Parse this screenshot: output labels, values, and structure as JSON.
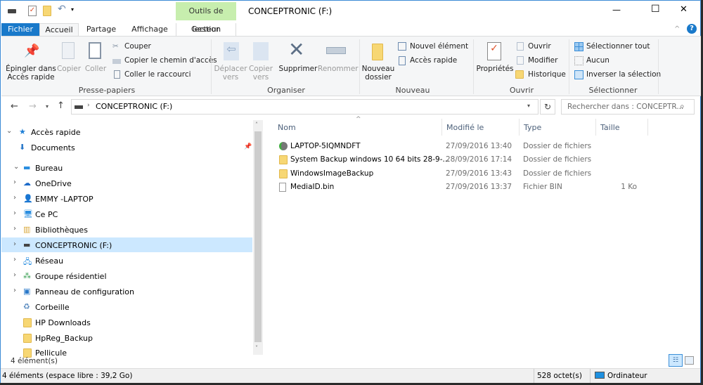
{
  "window": {
    "title": "CONCEPTRONIC (F:)",
    "context_tab": "Outils de lecteur",
    "controls": {
      "minimize": "—",
      "maximize": "☐",
      "close": "✕"
    }
  },
  "tabs": [
    "Fichier",
    "Accueil",
    "Partage",
    "Affichage",
    "Gestion"
  ],
  "ribbon": {
    "clipboard": {
      "pin": "Épingler dans Accès rapide",
      "copy": "Copier",
      "paste": "Coller",
      "cut": "Couper",
      "copy_path": "Copier le chemin d'accès",
      "paste_shortcut": "Coller le raccourci",
      "group": "Presse-papiers"
    },
    "organize": {
      "move": "Déplacer vers",
      "copy_to": "Copier vers",
      "delete": "Supprimer",
      "rename": "Renommer",
      "group": "Organiser"
    },
    "new": {
      "new_folder": "Nouveau dossier",
      "new_item": "Nouvel élément",
      "easy_access": "Accès rapide",
      "group": "Nouveau"
    },
    "open": {
      "properties": "Propriétés",
      "open": "Ouvrir",
      "edit": "Modifier",
      "history": "Historique",
      "group": "Ouvrir"
    },
    "select": {
      "all": "Sélectionner tout",
      "none": "Aucun",
      "invert": "Inverser la sélection",
      "group": "Sélectionner"
    }
  },
  "address": {
    "path": "CONCEPTRONIC (F:)",
    "search_placeholder": "Rechercher dans : CONCEPTR..."
  },
  "nav": [
    {
      "label": "Accès rapide",
      "icon": "star-icon"
    },
    {
      "label": "Documents",
      "icon": "download-icon"
    },
    {
      "label": "Bureau",
      "icon": "desktop-icon"
    },
    {
      "label": "OneDrive",
      "icon": "cloud-icon"
    },
    {
      "label": "EMMY -LAPTOP",
      "icon": "user-icon"
    },
    {
      "label": "Ce PC",
      "icon": "computer-icon"
    },
    {
      "label": "Bibliothèques",
      "icon": "library-icon"
    },
    {
      "label": "CONCEPTRONIC (F:)",
      "icon": "drive-icon",
      "selected": true
    },
    {
      "label": "Réseau",
      "icon": "network-icon"
    },
    {
      "label": "Groupe résidentiel",
      "icon": "homegroup-icon"
    },
    {
      "label": "Panneau de configuration",
      "icon": "control-panel-icon"
    },
    {
      "label": "Corbeille",
      "icon": "recycle-bin-icon"
    },
    {
      "label": "HP Downloads",
      "icon": "folder-icon"
    },
    {
      "label": "HpReg_Backup",
      "icon": "folder-icon"
    },
    {
      "label": "Pellicule",
      "icon": "folder-icon"
    }
  ],
  "columns": [
    "Nom",
    "Modifié le",
    "Type",
    "Taille"
  ],
  "files": [
    {
      "name": "LAPTOP-5IQMNDFT",
      "modified": "27/09/2016 13:40",
      "type": "Dossier de fichiers",
      "size": ""
    },
    {
      "name": "System Backup windows 10 64 bits 28-9-...",
      "modified": "28/09/2016 17:14",
      "type": "Dossier de fichiers",
      "size": ""
    },
    {
      "name": "WindowsImageBackup",
      "modified": "27/09/2016 13:43",
      "type": "Dossier de fichiers",
      "size": ""
    },
    {
      "name": "MediaID.bin",
      "modified": "27/09/2016 13:37",
      "type": "Fichier BIN",
      "size": "1 Ko"
    }
  ],
  "status": {
    "count": "4 élément(s)",
    "bottom_left": "4 éléments (espace libre : 39,2 Go)",
    "size": "528 octet(s)",
    "location": "Ordinateur"
  }
}
